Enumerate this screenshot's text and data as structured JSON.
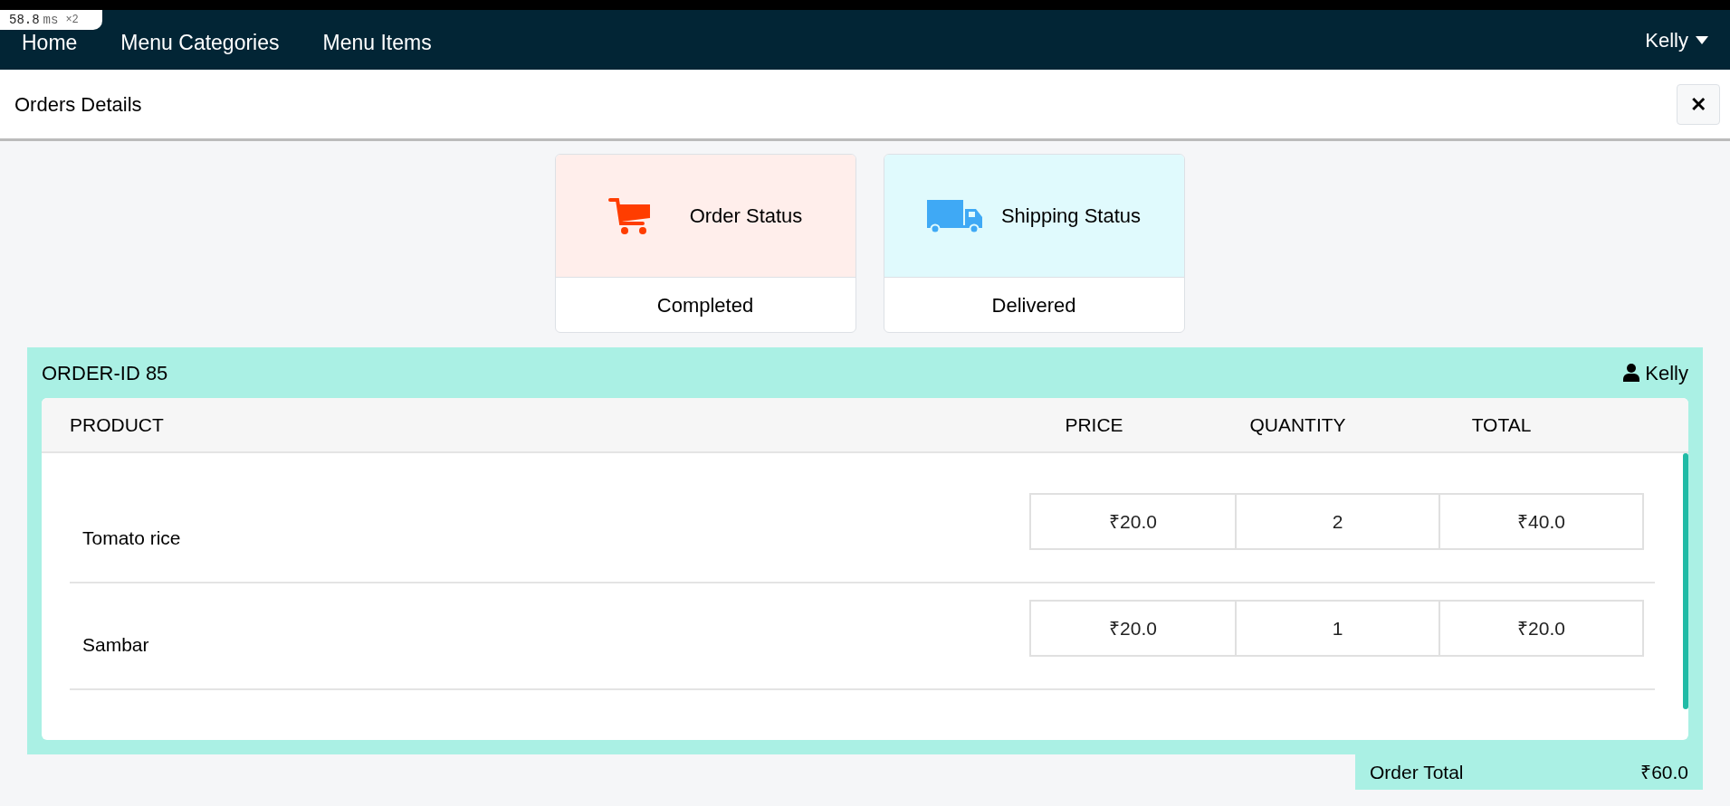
{
  "perf_overlay": {
    "value": "58.8",
    "unit": "ms",
    "multiplier": "×2"
  },
  "nav": {
    "items": [
      {
        "label": "Home"
      },
      {
        "label": "Menu Categories"
      },
      {
        "label": "Menu Items"
      }
    ],
    "user": "Kelly"
  },
  "header": {
    "title": "Orders Details",
    "close": "✕"
  },
  "status_cards": [
    {
      "kind": "cart",
      "title": "Order Status",
      "value": "Completed"
    },
    {
      "kind": "truck",
      "title": "Shipping Status",
      "value": "Delivered"
    }
  ],
  "order": {
    "id": "ORDER-ID 85",
    "customer": "Kelly",
    "table": {
      "columns": [
        "PRODUCT",
        "PRICE",
        "QUANTITY",
        "TOTAL"
      ],
      "rows": [
        {
          "product": "Tomato rice",
          "price": "₹20.0",
          "quantity": "2",
          "total": "₹40.0"
        },
        {
          "product": "Sambar",
          "price": "₹20.0",
          "quantity": "1",
          "total": "₹20.0"
        }
      ]
    },
    "total_label": "Order Total",
    "total": "₹60.0"
  }
}
